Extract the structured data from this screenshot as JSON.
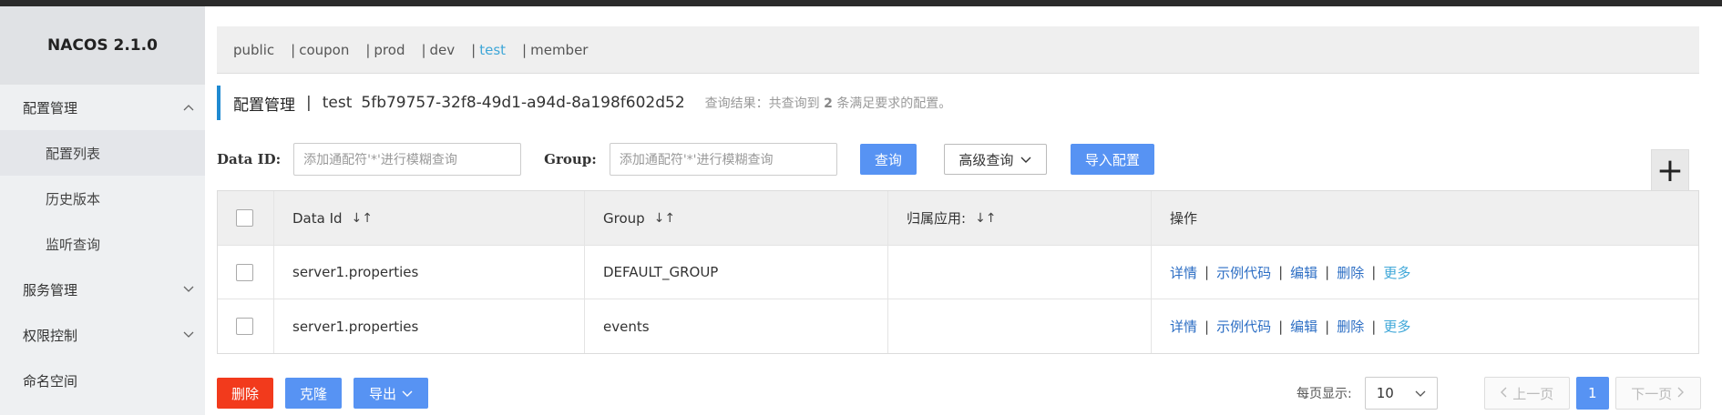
{
  "app": {
    "brand": "NACOS 2.1.0"
  },
  "sidebar": {
    "config_mgmt": "配置管理",
    "config_list": "配置列表",
    "history": "历史版本",
    "listen_query": "监听查询",
    "service_mgmt": "服务管理",
    "auth_control": "权限控制",
    "namespace": "命名空间"
  },
  "namespaces": [
    {
      "label": "public",
      "active": false
    },
    {
      "label": "coupon",
      "active": false
    },
    {
      "label": "prod",
      "active": false
    },
    {
      "label": "dev",
      "active": false
    },
    {
      "label": "test",
      "active": true
    },
    {
      "label": "member",
      "active": false
    }
  ],
  "header": {
    "title": "配置管理",
    "separator": "|",
    "namespace_name": "test",
    "namespace_id": "5fb79757-32f8-49d1-a94d-8a198f602d52",
    "result_prefix": "查询结果：共查询到",
    "result_count": "2",
    "result_suffix": "条满足要求的配置。"
  },
  "filters": {
    "data_id_label": "Data ID:",
    "data_id_placeholder": "添加通配符'*'进行模糊查询",
    "group_label": "Group:",
    "group_placeholder": "添加通配符'*'进行模糊查询",
    "query_button": "查询",
    "advanced_button": "高级查询",
    "import_button": "导入配置",
    "add_button": "+"
  },
  "table": {
    "columns": [
      "Data Id",
      "Group",
      "归属应用:",
      "操作"
    ],
    "sort_glyph": "↓↑",
    "rows": [
      {
        "data_id": "server1.properties",
        "group": "DEFAULT_GROUP",
        "app": ""
      },
      {
        "data_id": "server1.properties",
        "group": "events",
        "app": ""
      }
    ],
    "actions": {
      "detail": "详情",
      "sample_code": "示例代码",
      "edit": "编辑",
      "delete": "删除",
      "more": "更多",
      "sep": "|"
    }
  },
  "footer": {
    "delete_button": "删除",
    "clone_button": "克隆",
    "export_button": "导出",
    "page_size_label": "每页显示:",
    "page_size": "10",
    "prev_button": "上一页",
    "current_page": "1",
    "next_button": "下一页"
  }
}
